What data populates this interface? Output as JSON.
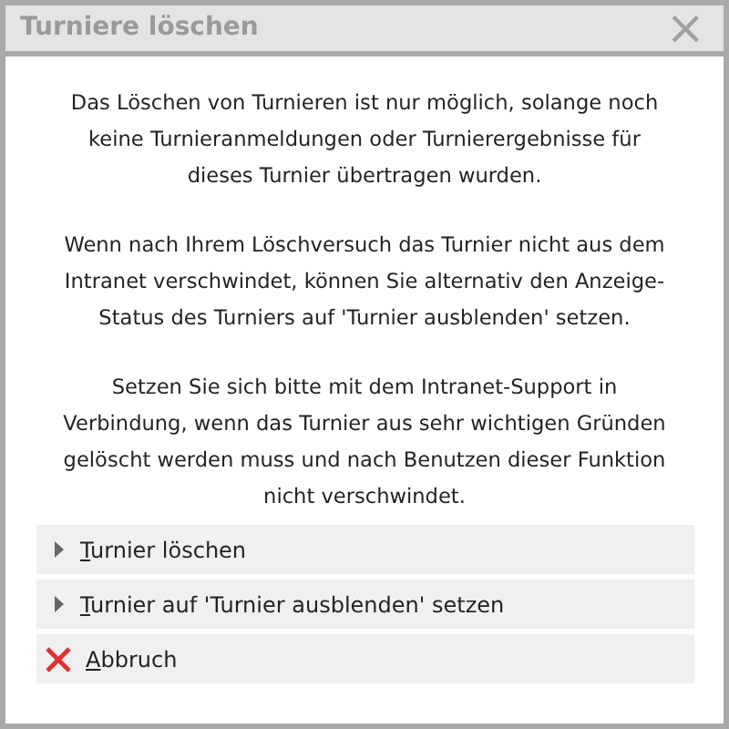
{
  "window": {
    "title": "Turniere löschen",
    "close": "×"
  },
  "paragraphs": [
    "Das Löschen von Turnieren ist nur möglich, solange noch keine Turnieranmeldungen oder Turnierergebnisse für dieses Turnier übertragen wurden.",
    "Wenn nach Ihrem Löschversuch das Turnier nicht aus dem Intranet verschwindet, können Sie alternativ den Anzeige-Status des Turniers auf 'Turnier ausblenden' setzen.",
    "Setzen Sie sich bitte mit dem Intranet-Support in Verbindung, wenn das Turnier aus sehr wichtigen Gründen gelöscht werden muss und nach Benutzen dieser Funktion nicht verschwindet."
  ],
  "actions": [
    {
      "kind": "expand",
      "label": "Turnier löschen",
      "mnemonic_underlined": true
    },
    {
      "kind": "expand",
      "label": "Turnier auf 'Turnier ausblenden' setzen",
      "mnemonic_underlined": true
    },
    {
      "kind": "cancel",
      "label": "Abbruch",
      "mnemonic_underlined": true
    }
  ]
}
